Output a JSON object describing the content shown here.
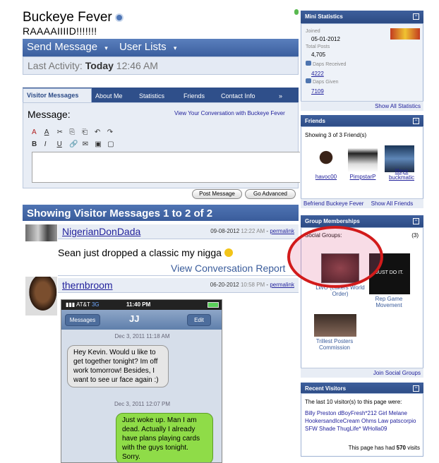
{
  "profile": {
    "name": "Buckeye Fever",
    "tagline": "RAAAAIIIID!!!!!!!"
  },
  "actions": {
    "send_message": "Send Message",
    "user_lists": "User Lists"
  },
  "activity": {
    "label": "Last Activity:",
    "day": "Today",
    "time": "12:46 AM"
  },
  "tabs": [
    "Visitor Messages",
    "About Me",
    "Statistics",
    "Friends",
    "Contact Info",
    "»"
  ],
  "message_form": {
    "label": "Message:",
    "conversation_link": "View Your Conversation with Buckeye Fever",
    "toolbar": [
      "A",
      "A",
      "✂",
      "⎘",
      "⎗",
      "↶",
      "↷",
      "B",
      "I",
      "U",
      "🔗",
      "✉",
      "▣",
      "▢"
    ],
    "post_button": "Post Message",
    "advanced_button": "Go Advanced"
  },
  "messages_section": {
    "title": "Showing Visitor Messages 1 to 2 of 2"
  },
  "messages": [
    {
      "user": "NigerianDonDada",
      "date": "09-08-2012",
      "time": "12:22 AM",
      "permalink": "permalink",
      "text": "Sean just dropped a classic my nigga",
      "view_conversation": "View Conversation",
      "report": "Report"
    },
    {
      "user": "thernbroom",
      "date": "06-20-2012",
      "time": "10:58 PM",
      "permalink": "permalink"
    }
  ],
  "phone": {
    "carrier": "AT&T",
    "network": "3G",
    "clock": "11:40 PM",
    "back_button": "Messages",
    "contact": "JJ",
    "edit_button": "Edit",
    "date1": "Dec 3, 2011 11:18 AM",
    "incoming": "Hey Kevin. Would u like to get together tonight? Im off work tomorrow! Besides, I want to see ur face again :)",
    "date2": "Dec 3, 2011 12:07 PM",
    "outgoing": "Just woke up. Man I am dead. Actually I already have plans playing cards with the guys tonight. Sorry."
  },
  "mini_statistics": {
    "title": "Mini Statistics",
    "joined_label": "Joined",
    "joined": "05-01-2012",
    "total_posts_label": "Total Posts",
    "total_posts": "4,705",
    "daps_received_label": "Daps Received",
    "daps_received": "4222",
    "daps_given_label": "Daps Given",
    "daps_given": "7109",
    "show_all": "Show All Statistics"
  },
  "friends": {
    "title": "Friends",
    "summary": "Showing 3 of 3 Friend(s)",
    "list": [
      "havoc00",
      "PimpstarP",
      "Illeye buckmatic"
    ],
    "befriend_link": "Befriend Buckeye Fever",
    "show_all": "Show All Friends"
  },
  "groups": {
    "title": "Group Memberships",
    "social_label": "Social Groups:",
    "count": "(3)",
    "items": [
      "LWO (Lakers World Order)",
      "Rep Game Movement",
      "Trillest Posters Commission"
    ],
    "justdoit_text": "JUST DO IT.",
    "join_link": "Join Social Groups"
  },
  "recent_visitors": {
    "title": "Recent Visitors",
    "intro": "The last 10 visitor(s) to this page were:",
    "names": [
      "Billy Preston",
      "dBoyFresh*212",
      "Girl Melane",
      "HookersandIceCream",
      "Ohms Law",
      "patscorpio",
      "SFW",
      "Shade",
      "ThugLife",
      "WHolla09"
    ],
    "visits_prefix": "This page has had",
    "visits": "570",
    "visits_suffix": "visits"
  }
}
